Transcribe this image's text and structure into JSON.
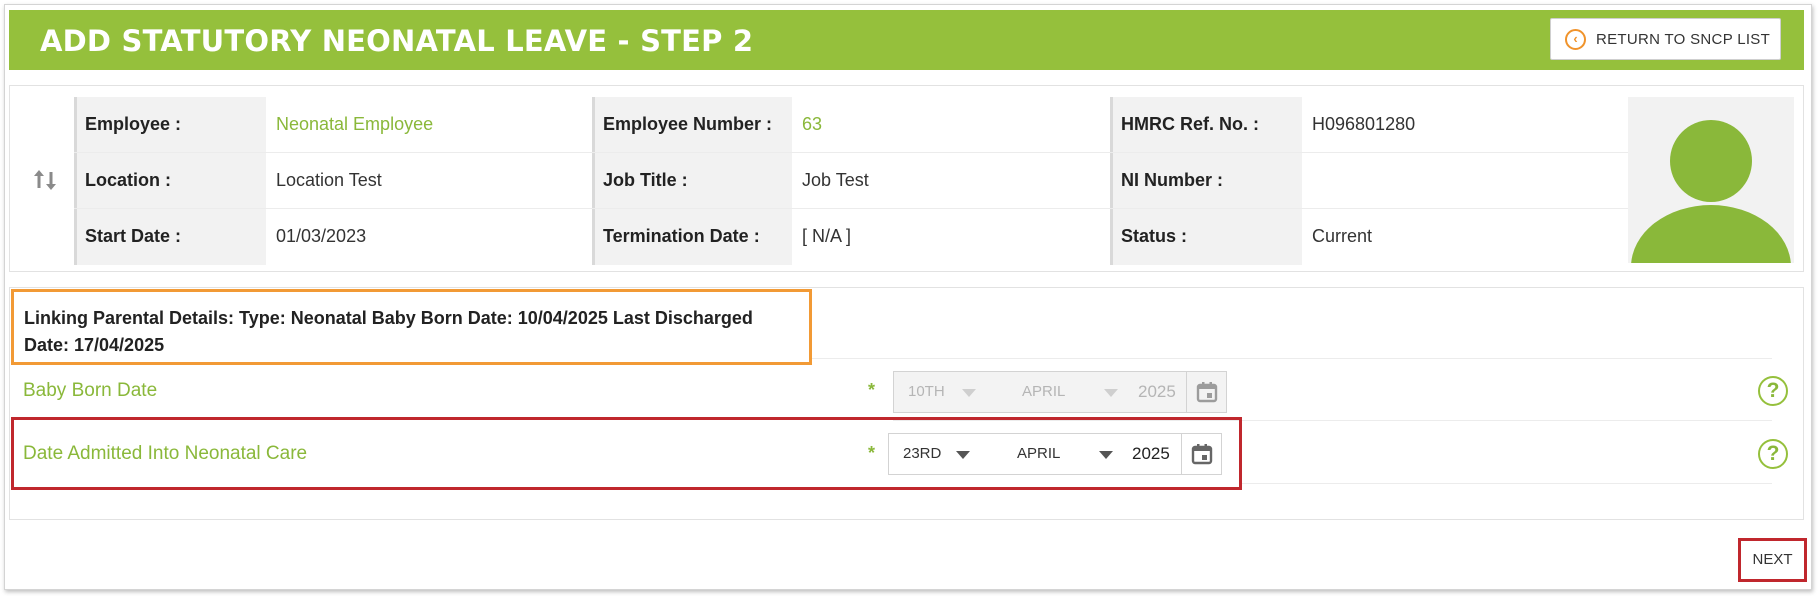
{
  "header": {
    "title": "ADD STATUTORY NEONATAL LEAVE - STEP 2",
    "return_button": "RETURN TO SNCP LIST"
  },
  "employee": {
    "rows": [
      [
        {
          "label": "Employee :",
          "value": "Neonatal Employee",
          "link": true
        },
        {
          "label": "Employee Number :",
          "value": "63",
          "link": true
        },
        {
          "label": "HMRC Ref. No. :",
          "value": "H096801280",
          "link": false
        }
      ],
      [
        {
          "label": "Location :",
          "value": "Location Test",
          "link": false
        },
        {
          "label": "Job Title :",
          "value": "Job Test",
          "link": false
        },
        {
          "label": "NI Number :",
          "value": "",
          "link": false
        }
      ],
      [
        {
          "label": "Start Date :",
          "value": "01/03/2023",
          "link": false
        },
        {
          "label": "Termination Date :",
          "value": "[ N/A ]",
          "link": false
        },
        {
          "label": "Status :",
          "value": "Current",
          "link": false
        }
      ]
    ]
  },
  "linking": {
    "text": "Linking Parental Details: Type: Neonatal Baby Born Date: 10/04/2025 Last Discharged Date: 17/04/2025"
  },
  "form": {
    "baby_born": {
      "label": "Baby Born Date",
      "required": "*",
      "day": "10TH",
      "month": "APRIL",
      "year": "2025"
    },
    "admitted": {
      "label": "Date Admitted Into Neonatal Care",
      "required": "*",
      "day": "23RD",
      "month": "APRIL",
      "year": "2025"
    },
    "help_symbol": "?"
  },
  "footer": {
    "next_button": "NEXT"
  },
  "colors": {
    "brand_green": "#95c03c",
    "highlight_orange": "#f29a35",
    "highlight_red": "#c0272d"
  }
}
